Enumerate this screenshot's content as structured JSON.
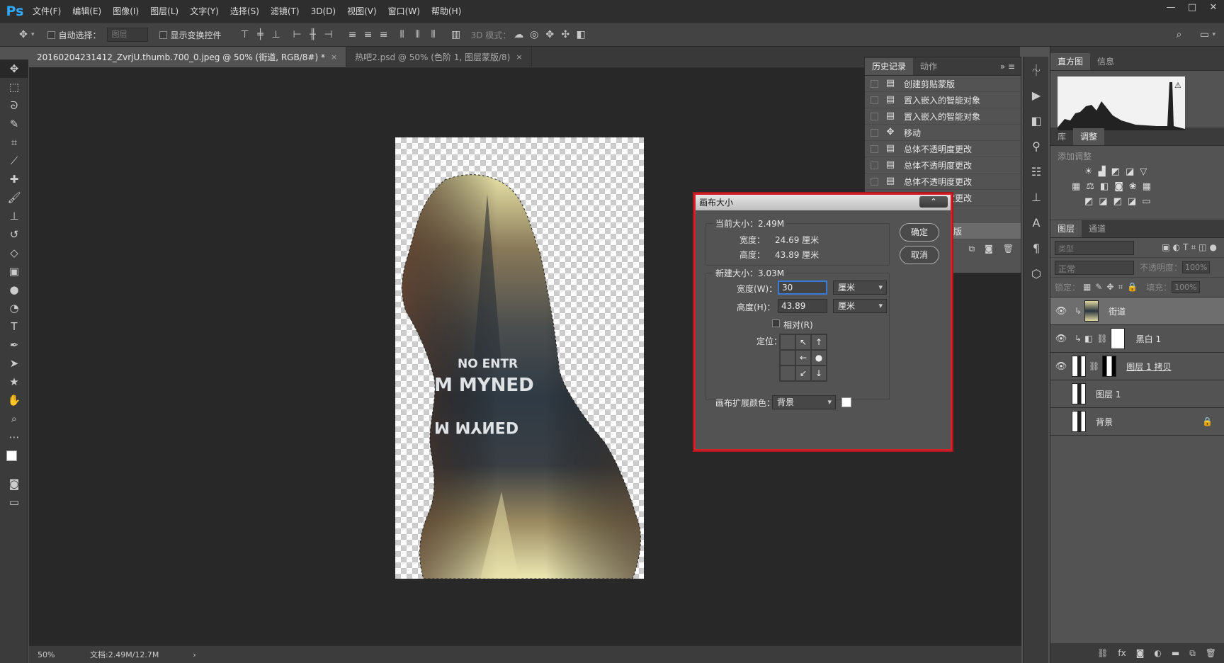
{
  "app": {
    "logo": "Ps"
  },
  "menu": [
    "文件(F)",
    "编辑(E)",
    "图像(I)",
    "图层(L)",
    "文字(Y)",
    "选择(S)",
    "滤镜(T)",
    "3D(D)",
    "视图(V)",
    "窗口(W)",
    "帮助(H)"
  ],
  "window_controls": [
    "—",
    "□",
    "✕"
  ],
  "options": {
    "auto_select": "自动选择：",
    "layer_dropdown": "图层",
    "show_transform": "显示变换控件",
    "mode_3d": "3D 模式："
  },
  "tabs": [
    {
      "label": "20160204231412_ZvrjU.thumb.700_0.jpeg @ 50% (街道, RGB/8#) *",
      "close": "×"
    },
    {
      "label": "热吧2.psd @ 50% (色阶 1, 图层蒙版/8)",
      "close": "×"
    }
  ],
  "status": {
    "zoom": "50%",
    "doc": "文档:2.49M/12.7M",
    "arrow": "›"
  },
  "history": {
    "tabs": [
      "历史记录",
      "动作"
    ],
    "items": [
      "创建剪贴蒙版",
      "置入嵌入的智能对象",
      "置入嵌入的智能对象",
      "移动",
      "总体不透明度更改",
      "总体不透明度更改",
      "总体不透明度更改",
      "总体不透明度更改"
    ],
    "partial": "版"
  },
  "histogram": {
    "tabs": [
      "直方图",
      "信息"
    ]
  },
  "adjust": {
    "tabs": [
      "库",
      "调整"
    ],
    "title": "添加调整"
  },
  "layers": {
    "tabs": [
      "图层",
      "通道"
    ],
    "filter": "类型",
    "blend": "正常",
    "opacity_label": "不透明度：",
    "opacity": "100%",
    "lock_label": "锁定：",
    "fill_label": "填充：",
    "fill": "100%",
    "items": [
      {
        "name": "街道",
        "visible": true
      },
      {
        "name": "黑白 1",
        "visible": true
      },
      {
        "name": "图层 1 拷贝",
        "visible": true
      },
      {
        "name": "图层 1",
        "visible": false
      },
      {
        "name": "背景",
        "visible": false
      }
    ]
  },
  "dialog": {
    "title": "画布大小",
    "current_legend": "当前大小：2.49M",
    "width_label": "宽度：",
    "width_value": "24.69 厘米",
    "height_label": "高度：",
    "height_value": "43.89 厘米",
    "new_legend": "新建大小：3.03M",
    "new_width_label": "宽度(W)：",
    "new_width": "30",
    "unit_w": "厘米",
    "new_height_label": "高度(H)：",
    "new_height": "43.89",
    "unit_h": "厘米",
    "relative": "相对(R)",
    "anchor_label": "定位：",
    "anchor": [
      "",
      "↖",
      "↑",
      "",
      "←",
      "●",
      "",
      "↙",
      "↓"
    ],
    "extend_label": "画布扩展颜色：",
    "extend_value": "背景",
    "ok": "确定",
    "cancel": "取消"
  },
  "colors": {
    "accent": "#31a8ff",
    "highlight_border": "#d6202a",
    "canvas_bg": "#282828"
  }
}
